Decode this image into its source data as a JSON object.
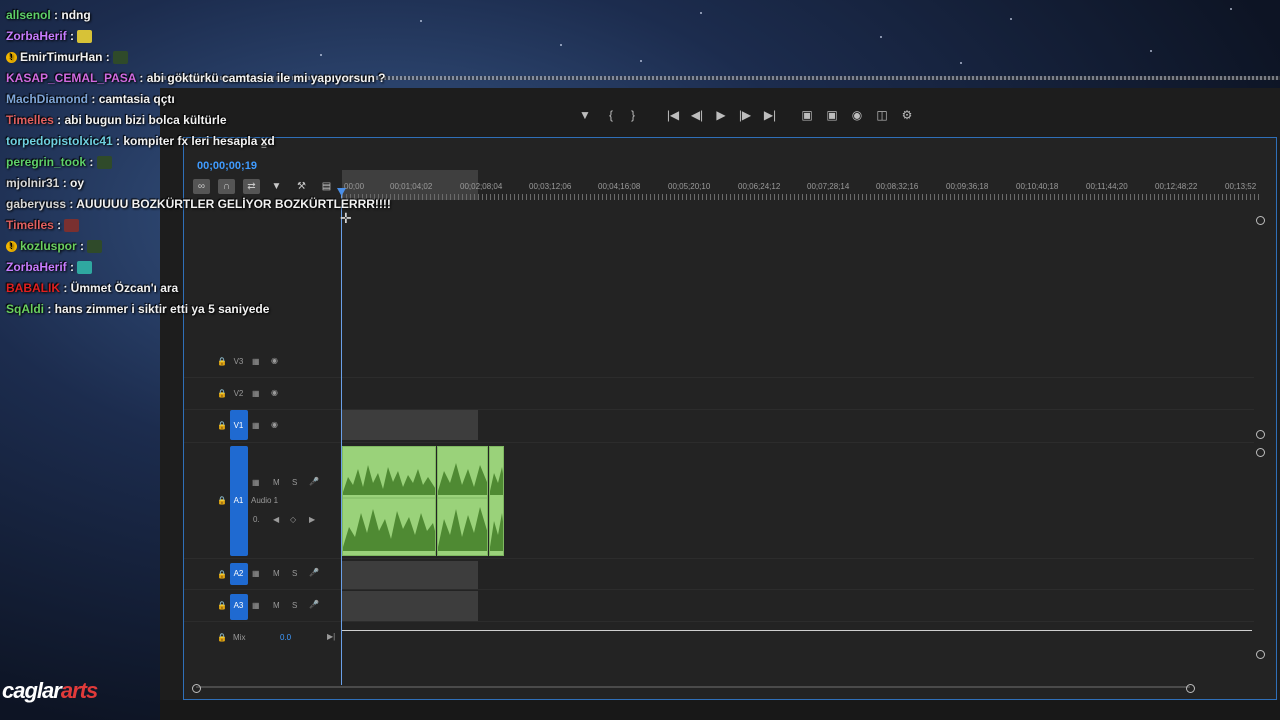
{
  "timeline": {
    "current_timecode": "00;00;00;19",
    "ruler_labels": [
      "00;00",
      "00;01;04;02",
      "00;02;08;04",
      "00;03;12;06",
      "00;04;16;08",
      "00;05;20;10",
      "00;06;24;12",
      "00;07;28;14",
      "00;08;32;16",
      "00;09;36;18",
      "00;10;40;18",
      "00;11;44;20",
      "00;12;48;22",
      "00;13;52"
    ],
    "tracks": {
      "v3": "V3",
      "v2": "V2",
      "v1": "V1",
      "a1": "A1",
      "a1_name": "Audio 1",
      "a1_vol": "0.",
      "a2": "A2",
      "a3": "A3",
      "mix": "Mix",
      "mix_value": "0.0",
      "mute": "M",
      "solo": "S"
    }
  },
  "chat": [
    {
      "user": "allsenol",
      "user_color": "#5ed06a",
      "message": "ndng"
    },
    {
      "user": "ZorbaHerif",
      "user_color": "#c77dff",
      "message": "",
      "emote": "#d7c237"
    },
    {
      "user": "EmirTimurHan",
      "user_color": "#f0f0f0",
      "message": "",
      "badge": "!",
      "emote": "#2f4a2a"
    },
    {
      "user": "KASAP_CEMAL_PASA",
      "user_color": "#d06ae0",
      "message": "abi göktürkü camtasia ile mi yapıyorsun ?"
    },
    {
      "user": "MachDiamond",
      "user_color": "#7fa6d8",
      "message": "camtasia qçtı"
    },
    {
      "user": "Timelles",
      "user_color": "#e06060",
      "message": "abi bugun bizi bolca kültürle"
    },
    {
      "user": "torpedopistolxic41",
      "user_color": "#6fd0e0",
      "message": "kompiter fx leri hesapla xd"
    },
    {
      "user": "peregrin_took",
      "user_color": "#5ed06a",
      "message": "",
      "emote": "#2f4a2a"
    },
    {
      "user": "mjolnir31",
      "user_color": "#d8d8d8",
      "message": "oy"
    },
    {
      "user": "gaberyuss",
      "user_color": "#d8d8d8",
      "message": "AUUUUU BOZKÜRTLER GELİYOR BOZKÜRTLERRR!!!!"
    },
    {
      "user": "Timelles",
      "user_color": "#e06060",
      "message": "",
      "emote": "#7a3030"
    },
    {
      "user": "kozluspor",
      "user_color": "#6ad060",
      "message": "",
      "badge": "!",
      "emote": "#2f4a2a"
    },
    {
      "user": "ZorbaHerif",
      "user_color": "#c77dff",
      "message": "",
      "emote": "#2fa8a0"
    },
    {
      "user": "BABALIK",
      "user_color": "#e02020",
      "message": "Ümmet Özcan'ı ara"
    },
    {
      "user": "SqAldi",
      "user_color": "#6ad060",
      "message": "hans zimmer i siktir etti ya 5 saniyede"
    }
  ],
  "logo": {
    "text_main": "caglar",
    "text_accent": "arts"
  },
  "colors": {
    "accent": "#3f9bff",
    "clip": "#9ad27a",
    "track_active": "#1f6ad1"
  }
}
